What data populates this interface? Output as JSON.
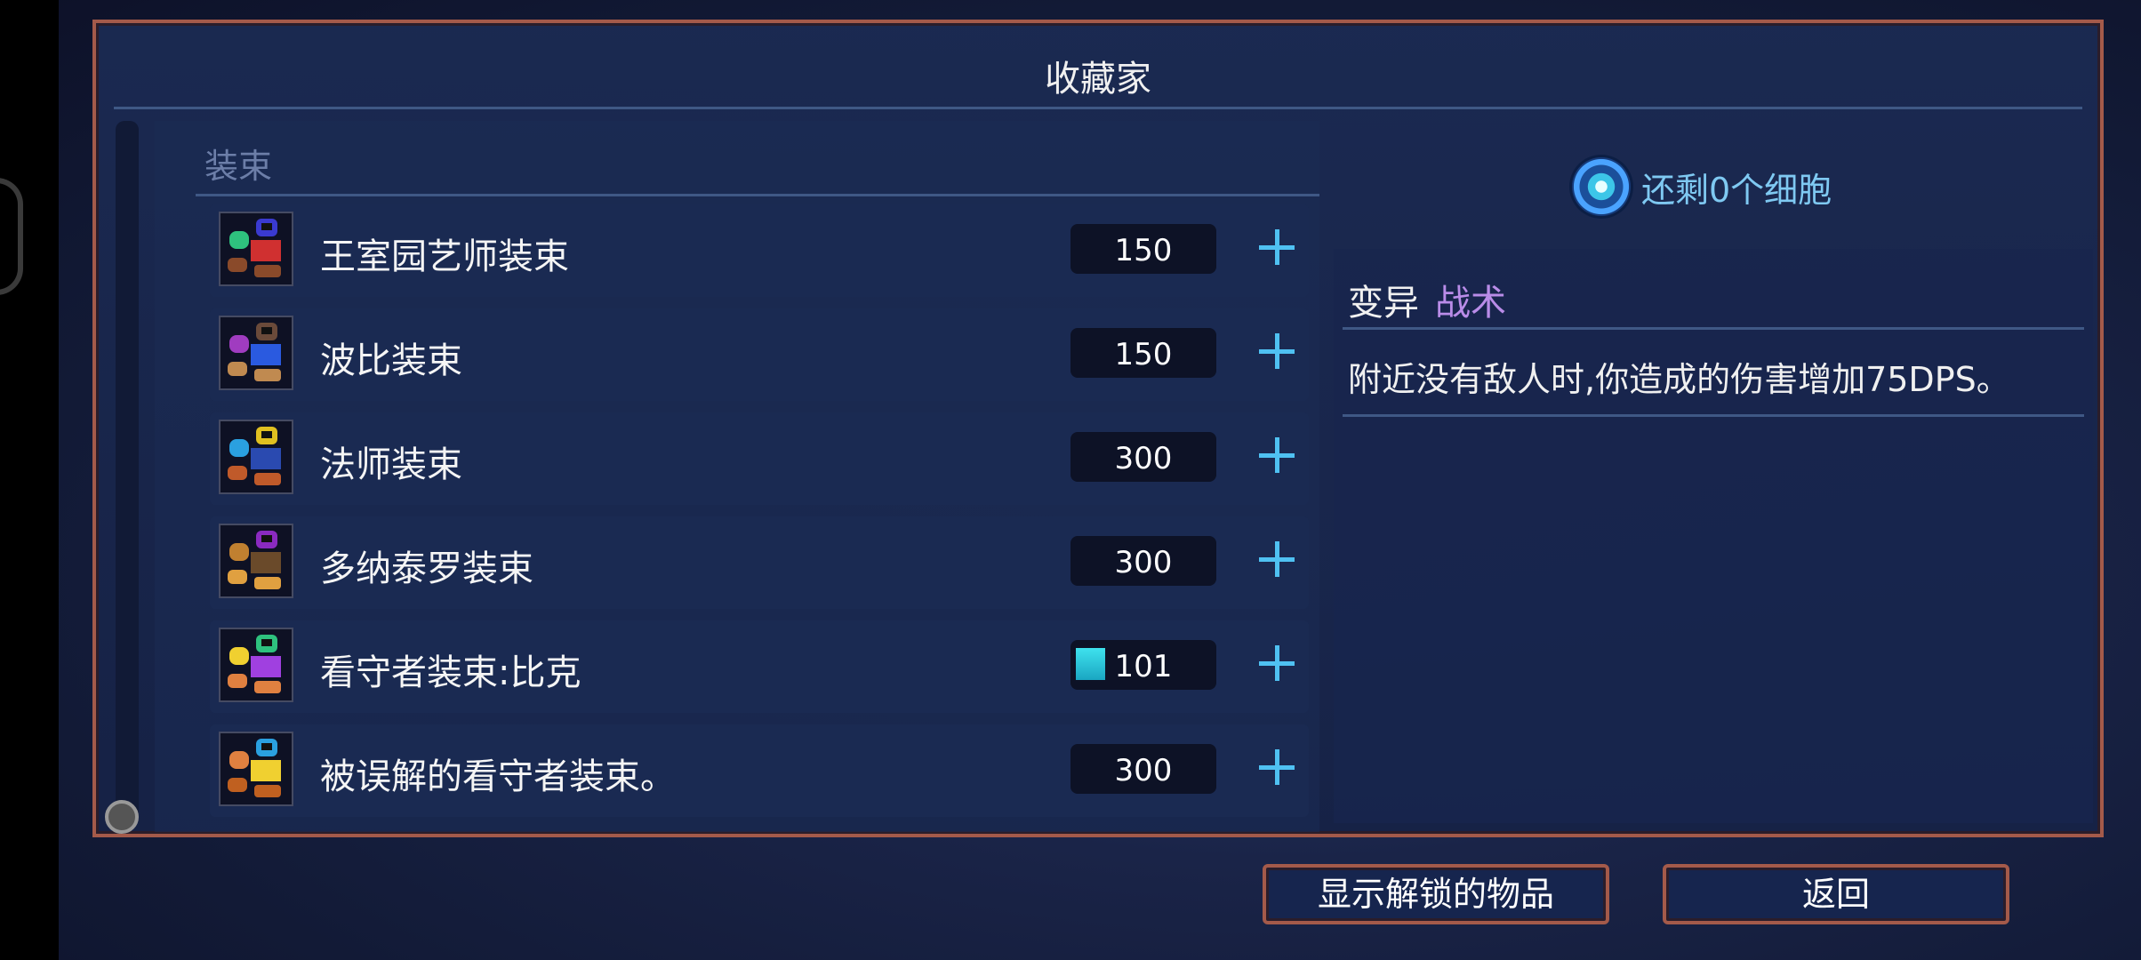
{
  "panel": {
    "title": "收藏家"
  },
  "section": {
    "label": "装束"
  },
  "items": [
    {
      "name": "王室园艺师装束",
      "price": "150",
      "palette": [
        "#2ec27e",
        "#3a3ad0",
        "#d03030",
        "#8a4a2a"
      ]
    },
    {
      "name": "波比装束",
      "price": "150",
      "palette": [
        "#a03cc0",
        "#6a4a3a",
        "#2a5ae0",
        "#c08a50"
      ]
    },
    {
      "name": "法师装束",
      "price": "300",
      "palette": [
        "#2aa0e0",
        "#e0c020",
        "#2a4ab0",
        "#c05a2a"
      ]
    },
    {
      "name": "多纳泰罗装束",
      "price": "300",
      "palette": [
        "#c08030",
        "#8a2ac0",
        "#6a4a2a",
        "#e0a040"
      ]
    },
    {
      "name": "看守者装束:比克",
      "price": "101",
      "progress": 0.22,
      "palette": [
        "#f0d030",
        "#2ec27e",
        "#a040e0",
        "#e08040"
      ]
    },
    {
      "name": "被误解的看守者装束。",
      "price": "300",
      "palette": [
        "#e08040",
        "#2aa0e0",
        "#f0d030",
        "#c06020"
      ]
    }
  ],
  "cells": {
    "text": "还剩0个细胞",
    "icon": "cell-icon"
  },
  "detail": {
    "type": "变异",
    "category": "战术",
    "description": "附近没有敌人时,你造成的伤害增加75DPS。"
  },
  "buttons": {
    "show_unlocked": "显示解锁的物品",
    "back": "返回"
  },
  "colors": {
    "panel_border": "#a45a4a",
    "plus": "#4fc1f2",
    "category": "#b98ce8",
    "cells_text": "#7fc9f2",
    "progress": "#3fe2ee"
  }
}
